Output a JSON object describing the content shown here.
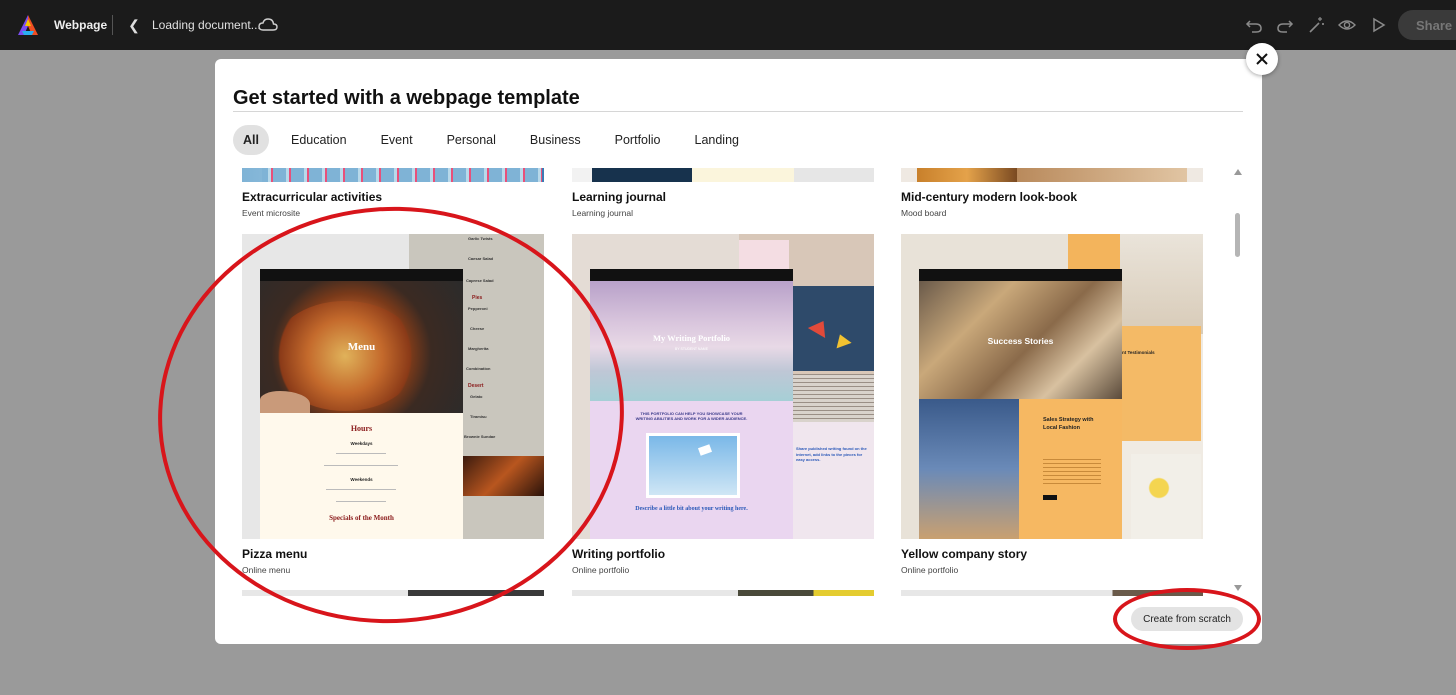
{
  "topbar": {
    "app_name": "Webpage",
    "doc_title": "Loading document...",
    "share_label": "Share"
  },
  "modal": {
    "title": "Get started with a webpage template",
    "tabs": [
      {
        "label": "All",
        "active": true
      },
      {
        "label": "Education"
      },
      {
        "label": "Event"
      },
      {
        "label": "Personal"
      },
      {
        "label": "Business"
      },
      {
        "label": "Portfolio"
      },
      {
        "label": "Landing"
      }
    ],
    "create_label": "Create from scratch"
  },
  "templates": {
    "row1": [
      {
        "title": "Extracurricular activities",
        "subtitle": "Event microsite"
      },
      {
        "title": "Learning journal",
        "subtitle": "Learning journal"
      },
      {
        "title": "Mid-century modern look-book",
        "subtitle": "Mood board"
      }
    ],
    "row2": [
      {
        "title": "Pizza menu",
        "subtitle": "Online menu"
      },
      {
        "title": "Writing portfolio",
        "subtitle": "Online portfolio"
      },
      {
        "title": "Yellow company story",
        "subtitle": "Online portfolio"
      }
    ]
  },
  "pizza": {
    "hero": "Menu",
    "hours": "Hours",
    "weekdays": "Weekdays",
    "weekends": "Weekends",
    "specials": "Specials of the Month",
    "menu_items": [
      "Garlic Twists",
      "Caesar Salad",
      "Caprese Salad",
      "Pies",
      "Pepperoni",
      "Cheese",
      "Margherita",
      "Combination",
      "Desert",
      "Gelato",
      "Tiramisu",
      "Brownie Sundae"
    ]
  },
  "writing": {
    "hero": "My Writing Portfolio",
    "byline": "BY STUDENT NAME",
    "intro": "THIS PORTFOLIO CAN HELP YOU SHOWCASE YOUR WRITING ABILITIES AND WORK FOR A WIDER AUDIENCE.",
    "describe": "Describe a little bit about your writing here.",
    "published": "Share published writing found on the internet, add links to the pieces for easy access."
  },
  "yellow": {
    "hero": "Success Stories",
    "testimonials": "nt Testimonials",
    "strategy": "Sales Strategy with Local Fashion"
  },
  "colors": {
    "topbar": "#1b1b1b",
    "backdrop": "#9a9a9a",
    "annotation": "#d8151b",
    "pizza_red": "#8a1a1a"
  }
}
